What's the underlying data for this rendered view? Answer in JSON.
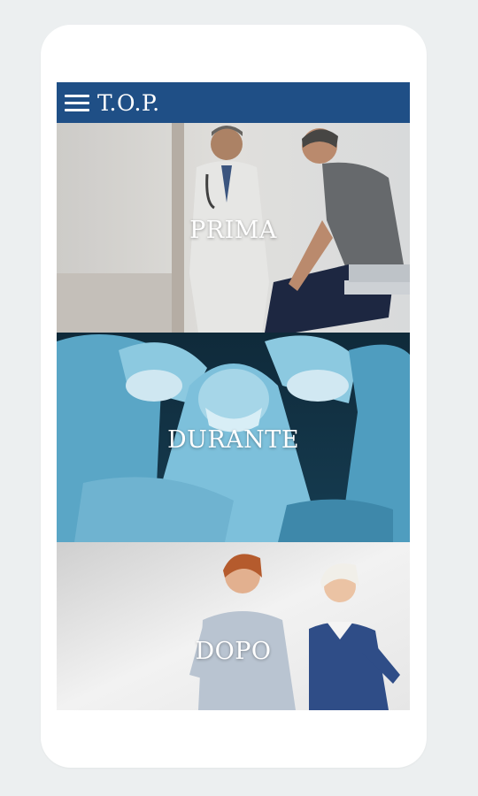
{
  "app": {
    "title": "T.O.P.",
    "menu_icon": "hamburger-menu-icon",
    "bar_color": "#1f4f86"
  },
  "tiles": [
    {
      "label": "PRIMA",
      "image": "doctor-examining-patient-photo"
    },
    {
      "label": "DURANTE",
      "image": "surgeons-operating-photo"
    },
    {
      "label": "DOPO",
      "image": "smiling-women-walking-photo"
    }
  ]
}
